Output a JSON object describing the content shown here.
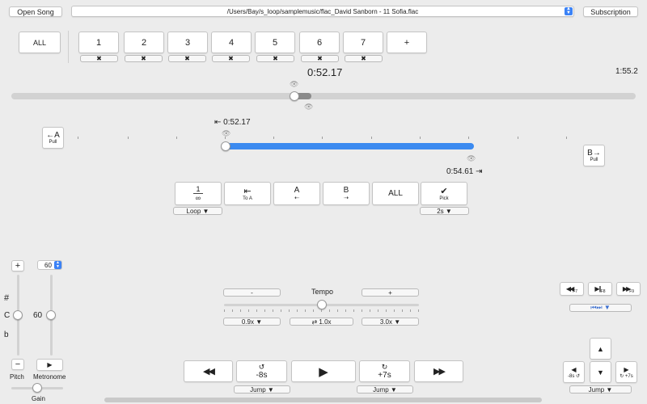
{
  "toolbar": {
    "open_song": "Open Song",
    "file_path": "/Users/Bay/s_loop/samplemusic/flac_David Sanborn - 11 Sofia.flac",
    "subscription": "Subscription"
  },
  "sections": {
    "all_label": "ALL",
    "items": [
      "1",
      "2",
      "3",
      "4",
      "5",
      "6",
      "7"
    ],
    "add_label": "+",
    "remove_glyph": "✖"
  },
  "position": {
    "current": "0:52.17",
    "total": "1:55.2",
    "progress_fraction": 0.45
  },
  "loop": {
    "pull_a_arrow": "←A",
    "pull_a_label": "Pull",
    "pull_b_arrow": "B→",
    "pull_b_label": "Pull",
    "start_prefix": "⇤",
    "start_time": "0:52.17",
    "end_time": "0:54.61",
    "end_suffix": "⇥",
    "range_start_fraction": 0.0,
    "range_end_fraction": 1.0
  },
  "loop_controls": {
    "count_top": "1",
    "count_bottom": "∞",
    "to_a_icon": "⇤",
    "to_a_label": "To A",
    "a_label": "A",
    "a_sub": "⇠",
    "b_label": "B",
    "b_sub": "⇢",
    "all_label": "ALL",
    "pick_icon": "✔",
    "pick_label": "Pick",
    "loop_dropdown": "Loop ▼",
    "pick_dropdown": "2s ▼"
  },
  "pitch": {
    "plus": "+",
    "minus": "−",
    "sharp": "#",
    "natural": "C",
    "flat": "b",
    "label": "Pitch",
    "level_fraction": 0.5
  },
  "metronome": {
    "bpm": "60",
    "value": "60",
    "play_glyph": "▶",
    "label": "Metronome",
    "level_fraction": 0.5
  },
  "gain": {
    "label": "Gain",
    "level_fraction": 0.5
  },
  "tempo": {
    "title": "Tempo",
    "minus": "-",
    "plus": "+",
    "min": "0.9x ▼",
    "reset": "⇄ 1.0x",
    "max": "3.0x ▼",
    "level_fraction": 0.5
  },
  "transport": {
    "rewind": "◀◀",
    "back_icon": "↺",
    "back_label": "-8s",
    "play": "▶",
    "fwd_icon": "↻",
    "fwd_label": "+7s",
    "fast_forward": "▶▶",
    "jump_back_dropdown": "Jump ▼",
    "jump_fwd_dropdown": "Jump ▼"
  },
  "media_keys": {
    "prev": "◀◀",
    "prev_key": "F7",
    "play_pause": "▶||",
    "play_pause_key": "F8",
    "next": "▶▶",
    "next_key": "F9",
    "dropdown": "⏮⏭ ▼"
  },
  "dpad": {
    "up": "▲",
    "down": "▼",
    "left": "◀",
    "left_label": "-8s ↺",
    "right": "▶",
    "right_label": "↻ +7s",
    "dropdown": "Jump ▼"
  }
}
